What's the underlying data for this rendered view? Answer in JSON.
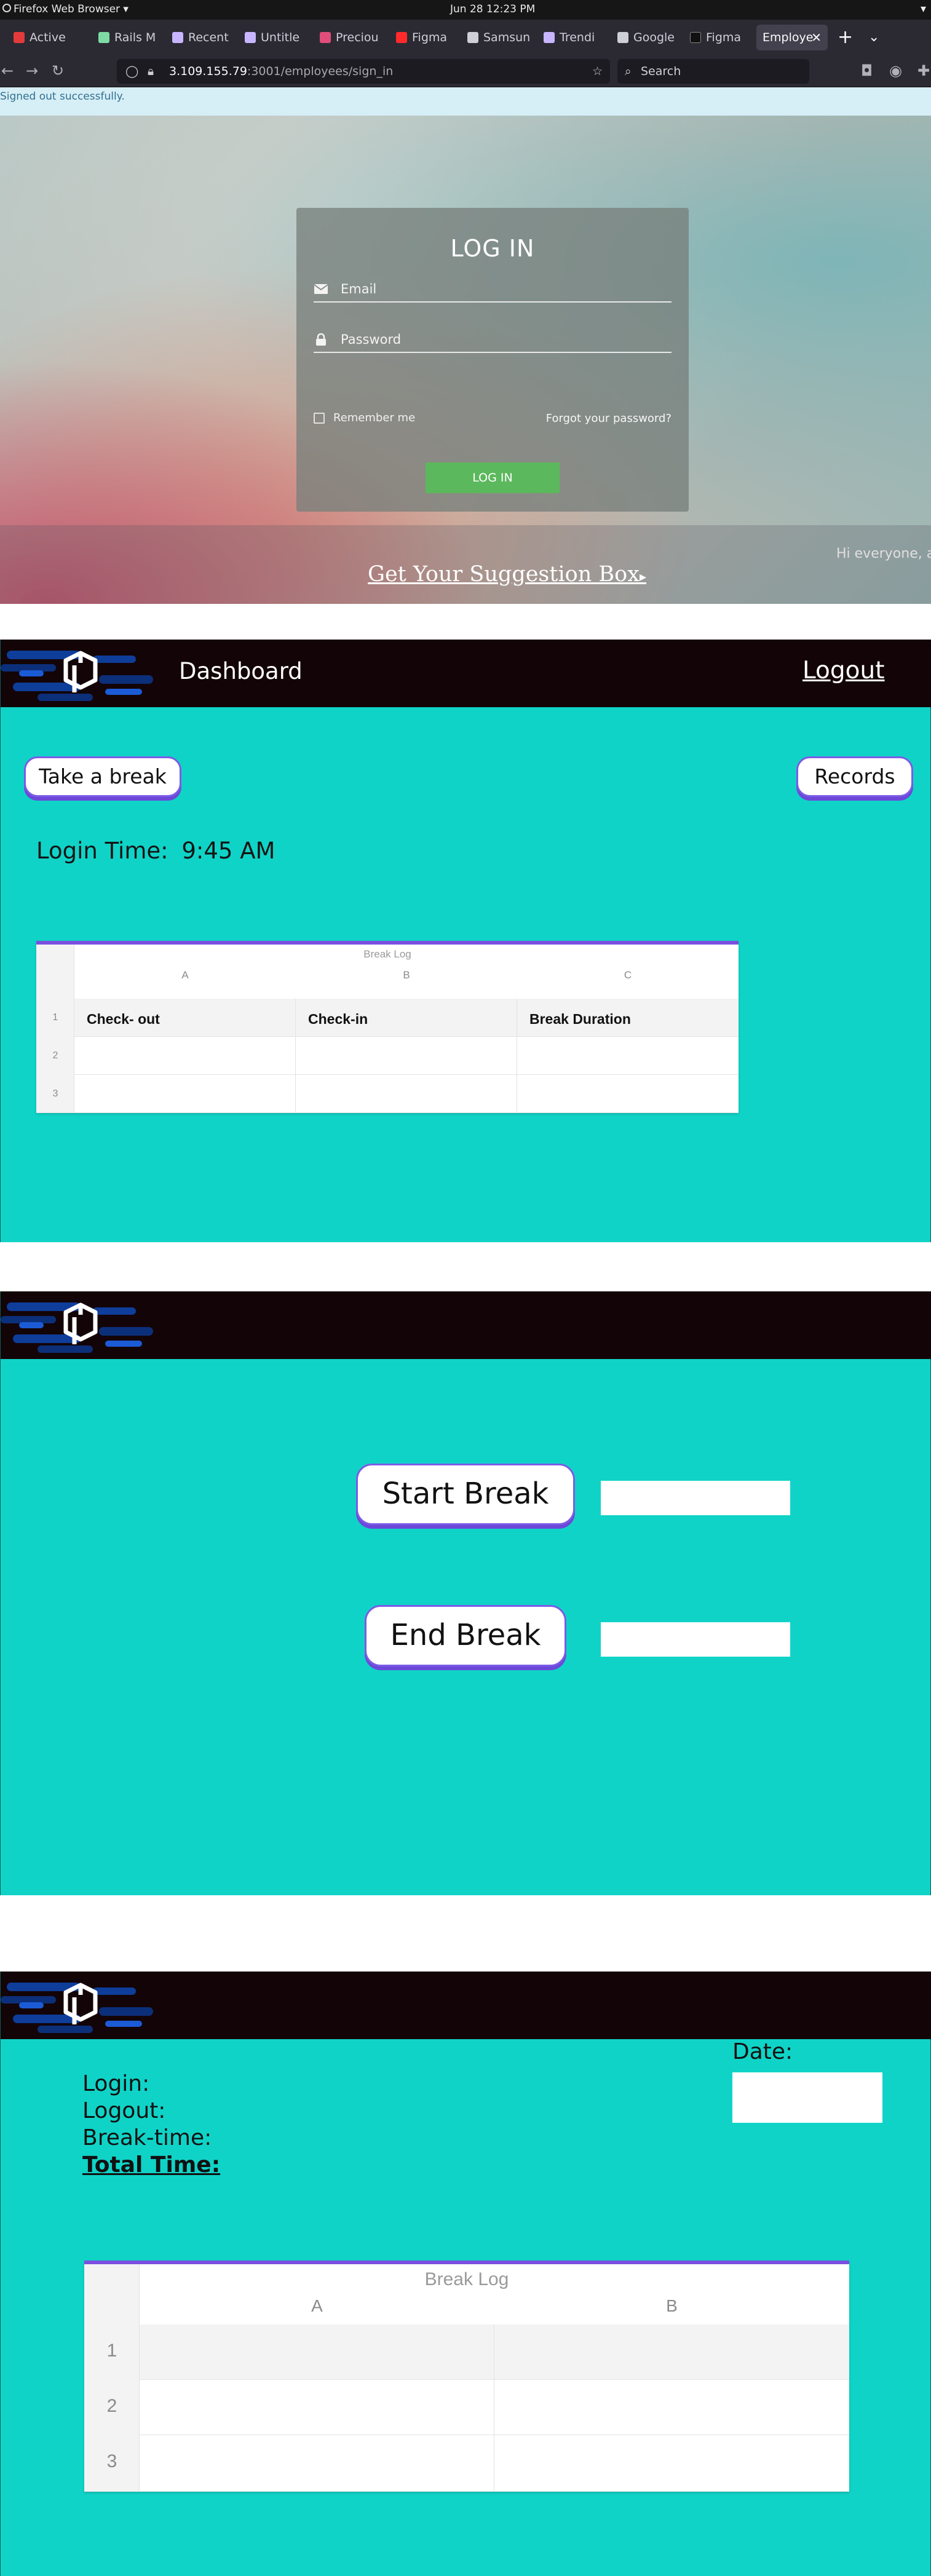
{
  "browser": {
    "app_name": "Firefox Web Browser ▾",
    "clock": "Jun 28  12:23 PM",
    "tabs": [
      {
        "label": "Active",
        "color": "#e33b3b"
      },
      {
        "label": "Rails M",
        "color": "#7ddba3"
      },
      {
        "label": "Recent",
        "color": "#c7b6ff"
      },
      {
        "label": "Untitle",
        "color": "#c7b6ff"
      },
      {
        "label": "Preciou",
        "color": "#e04d7a"
      },
      {
        "label": "Figma",
        "color": "#ff2a2a"
      },
      {
        "label": "Samsun",
        "color": "#cfcfd8"
      },
      {
        "label": "Trendi",
        "color": "#c7b6ff"
      },
      {
        "label": "Google",
        "color": "#cfcfd8"
      },
      {
        "label": "Figma",
        "color": "#111111"
      },
      {
        "label": "Employe",
        "color": "#42414d"
      }
    ],
    "url_host": "3.109.155.79",
    "url_rest": ":3001/employees/sign_in",
    "search_placeholder": "Search"
  },
  "login_page": {
    "flash": "Signed out successfully.",
    "title": "LOG IN",
    "email_placeholder": "Email",
    "password_placeholder": "Password",
    "remember_label": "Remember me",
    "forgot_label": "Forgot your password?",
    "login_button": "LOG IN",
    "band_text": "Hi everyone, an",
    "suggestion_link": "Get Your Suggestion Box"
  },
  "dashboard": {
    "title": "Dashboard",
    "logout": "Logout",
    "take_break": "Take a break",
    "records": "Records",
    "login_time_label": "Login Time:",
    "login_time_value": "9:45 AM",
    "sheet": {
      "caption": "Break Log",
      "columns": [
        "A",
        "B",
        "C"
      ],
      "rows": [
        "1",
        "2",
        "3"
      ],
      "headers": [
        "Check- out",
        "Check-in",
        "Break Duration"
      ]
    }
  },
  "break_page": {
    "start_break": "Start Break",
    "end_break": "End Break"
  },
  "records_page": {
    "date_label": "Date:",
    "login_label": "Login:",
    "logout_label": "Logout:",
    "break_time_label": "Break-time:",
    "total_time_label": "Total Time:",
    "sheet": {
      "caption": "Break Log",
      "columns": [
        "A",
        "B"
      ],
      "rows": [
        "1",
        "2",
        "3"
      ]
    }
  },
  "colors": {
    "app_background": "#10d3c7",
    "topbar": "#130407",
    "button_border": "#7b5be6",
    "login_button": "#5cb85c"
  }
}
